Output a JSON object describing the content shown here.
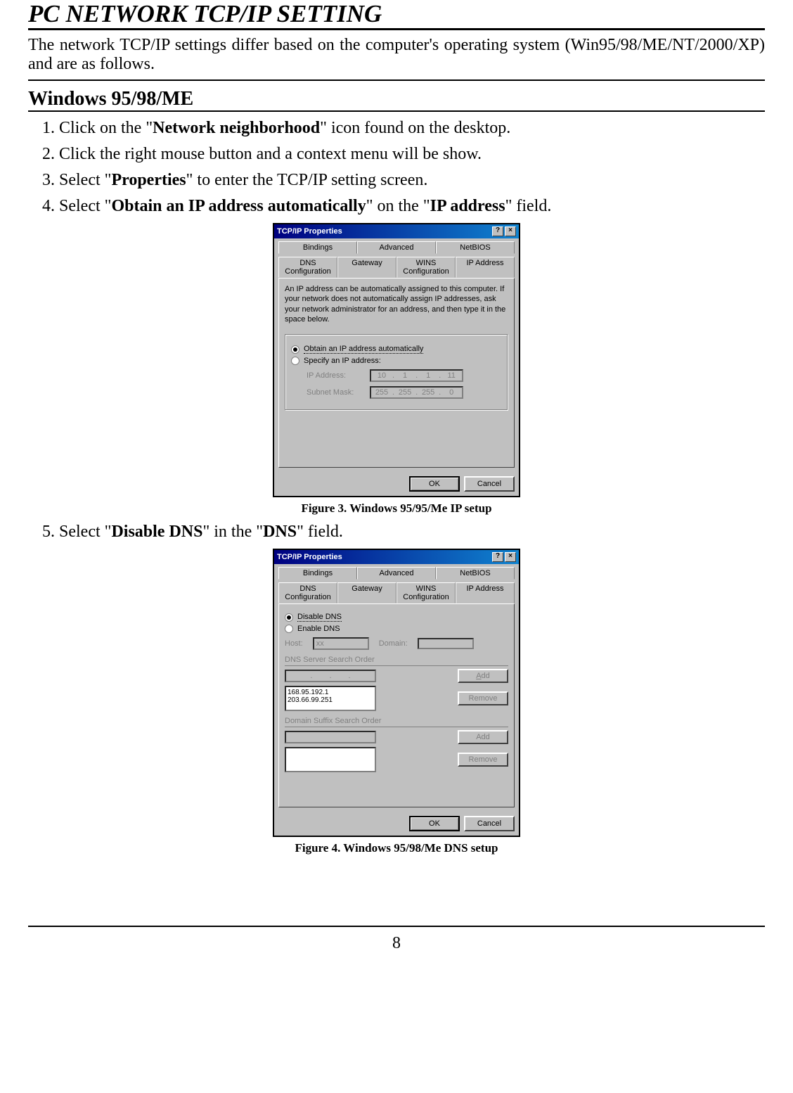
{
  "title": "PC NETWORK TCP/IP SETTING",
  "intro": "The network TCP/IP settings differ based on the computer's operating system (Win95/98/ME/NT/2000/XP) and are as follows.",
  "subtitle": "Windows 95/98/ME",
  "steps": {
    "s1_pre": "1.  Click on the \"",
    "s1_bold": "Network neighborhood",
    "s1_post": "\" icon found on the desktop.",
    "s2": "2.  Click the right mouse button and a context menu will be show.",
    "s3_pre": "3.  Select \"",
    "s3_bold": "Properties",
    "s3_post": "\" to enter the TCP/IP setting screen.",
    "s4_pre": "4.  Select \"",
    "s4_bold1": "Obtain an IP address automatically",
    "s4_mid": "\" on the \"",
    "s4_bold2": "IP address",
    "s4_post": "\" field.",
    "s5_pre": "5.  Select \"",
    "s5_bold1": "Disable DNS",
    "s5_mid": "\" in the \"",
    "s5_bold2": "DNS",
    "s5_post": "\" field."
  },
  "fig1": {
    "dialog_title": "TCP/IP Properties",
    "tabs_top": [
      "Bindings",
      "Advanced",
      "NetBIOS"
    ],
    "tabs_bottom": [
      "DNS Configuration",
      "Gateway",
      "WINS Configuration",
      "IP Address"
    ],
    "desc": "An IP address can be automatically assigned to this computer. If your network does not automatically assign IP addresses, ask your network administrator for an address, and then type it in the space below.",
    "radio_auto": "Obtain an IP address automatically",
    "radio_specify": "Specify an IP address:",
    "ip_label": "IP Address:",
    "ip_value": [
      "10",
      "1",
      "1",
      "11"
    ],
    "subnet_label": "Subnet Mask:",
    "subnet_value": [
      "255",
      "255",
      "255",
      "0"
    ],
    "ok": "OK",
    "cancel": "Cancel",
    "caption": "Figure 3. Windows 95/95/Me IP setup"
  },
  "fig2": {
    "dialog_title": "TCP/IP Properties",
    "tabs_top": [
      "Bindings",
      "Advanced",
      "NetBIOS"
    ],
    "tabs_bottom": [
      "DNS Configuration",
      "Gateway",
      "WINS Configuration",
      "IP Address"
    ],
    "radio_disable": "Disable DNS",
    "radio_enable": "Enable DNS",
    "host_label": "Host:",
    "host_value": "xx",
    "domain_label": "Domain:",
    "dns_order": "DNS Server Search Order",
    "dns_list": [
      "168.95.192.1",
      "203.66.99.251"
    ],
    "suffix_order": "Domain Suffix Search Order",
    "add": "Add",
    "remove": "Remove",
    "ok": "OK",
    "cancel": "Cancel",
    "caption": "Figure 4. Windows 95/98/Me DNS setup"
  },
  "page_number": "8"
}
